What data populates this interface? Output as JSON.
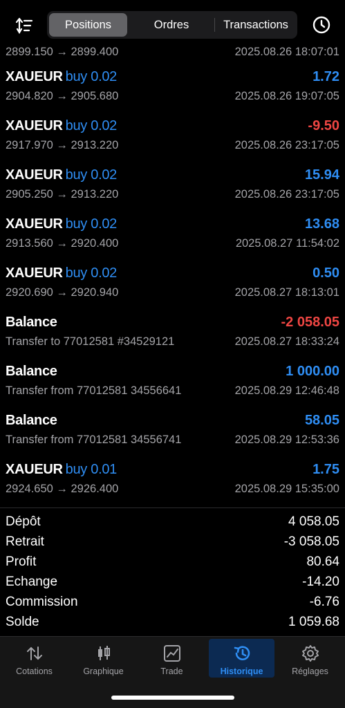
{
  "header": {
    "tabs": [
      "Positions",
      "Ordres",
      "Transactions"
    ],
    "active_tab": "Positions"
  },
  "history": [
    {
      "first": true,
      "symbol": "",
      "side": "",
      "amount": "",
      "detail": "2899.150 → 2899.400",
      "time": "2025.08.26 18:07:01"
    },
    {
      "symbol": "XAUEUR",
      "side": "buy 0.02",
      "amount": "1.72",
      "kind": "pos",
      "detail": "2904.820 → 2905.680",
      "time": "2025.08.26 19:07:05"
    },
    {
      "symbol": "XAUEUR",
      "side": "buy 0.02",
      "amount": "-9.50",
      "kind": "neg",
      "detail": "2917.970 → 2913.220",
      "time": "2025.08.26 23:17:05"
    },
    {
      "symbol": "XAUEUR",
      "side": "buy 0.02",
      "amount": "15.94",
      "kind": "pos",
      "detail": "2905.250 → 2913.220",
      "time": "2025.08.26 23:17:05"
    },
    {
      "symbol": "XAUEUR",
      "side": "buy 0.02",
      "amount": "13.68",
      "kind": "pos",
      "detail": "2913.560 → 2920.400",
      "time": "2025.08.27 11:54:02"
    },
    {
      "symbol": "XAUEUR",
      "side": "buy 0.02",
      "amount": "0.50",
      "kind": "pos",
      "detail": "2920.690 → 2920.940",
      "time": "2025.08.27 18:13:01"
    },
    {
      "symbol": "Balance",
      "side": "",
      "amount": "-2 058.05",
      "kind": "neg",
      "detail": "Transfer to 77012581 #34529121",
      "time": "2025.08.27 18:33:24"
    },
    {
      "symbol": "Balance",
      "side": "",
      "amount": "1 000.00",
      "kind": "pos",
      "detail": "Transfer from 77012581 34556641",
      "time": "2025.08.29 12:46:48"
    },
    {
      "symbol": "Balance",
      "side": "",
      "amount": "58.05",
      "kind": "pos",
      "detail": "Transfer from 77012581 34556741",
      "time": "2025.08.29 12:53:36"
    },
    {
      "symbol": "XAUEUR",
      "side": "buy 0.01",
      "amount": "1.75",
      "kind": "pos",
      "detail": "2924.650 → 2926.400",
      "time": "2025.08.29 15:35:00"
    }
  ],
  "summary": [
    {
      "label": "Dépôt",
      "value": "4 058.05"
    },
    {
      "label": "Retrait",
      "value": "-3 058.05"
    },
    {
      "label": "Profit",
      "value": "80.64"
    },
    {
      "label": "Echange",
      "value": "-14.20"
    },
    {
      "label": "Commission",
      "value": "-6.76"
    },
    {
      "label": "Solde",
      "value": "1 059.68"
    }
  ],
  "tabbar": [
    {
      "label": "Cotations",
      "icon": "arrows-updown-icon"
    },
    {
      "label": "Graphique",
      "icon": "candlestick-icon"
    },
    {
      "label": "Trade",
      "icon": "chart-box-icon"
    },
    {
      "label": "Historique",
      "icon": "history-icon",
      "active": true
    },
    {
      "label": "Réglages",
      "icon": "gear-icon"
    }
  ],
  "colors": {
    "accent": "#2f8ef4",
    "loss": "#ef4643",
    "muted": "#a4a4a8"
  }
}
